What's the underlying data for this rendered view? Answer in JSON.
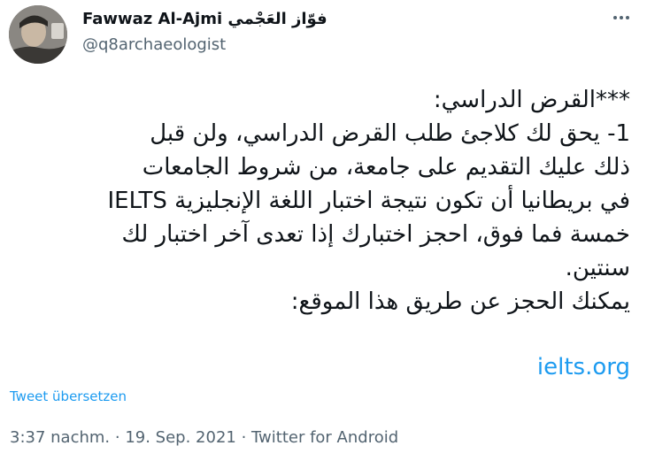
{
  "author": {
    "display_name": "Fawwaz Al-Ajmi فوّاز العَجْمي",
    "handle": "@q8archaeologist"
  },
  "icons": {
    "avatar": "profile-photo",
    "more": "more-options-icon"
  },
  "tweet": {
    "lines": [
      "***القرض الدراسي:",
      "1- يحق لك كلاجئ طلب القرض الدراسي، ولن قبل",
      "ذلك عليك التقديم على جامعة، من شروط الجامعات",
      "في بريطانيا أن تكون نتيجة اختبار اللغة الإنجليزية IELTS",
      "خمسة فما فوق، احجز اختبارك إذا تعدى آخر اختبار لك",
      "سنتين.",
      "يمكنك الحجز عن طريق هذا الموقع:"
    ],
    "link": "ielts.org",
    "translate_label": "Tweet übersetzen"
  },
  "meta": {
    "time": "3:37 nachm.",
    "separator": " · ",
    "date": "19. Sep. 2021",
    "source": "Twitter for Android"
  },
  "colors": {
    "text": "#0f1419",
    "secondary": "#536471",
    "accent": "#1d9bf0"
  }
}
